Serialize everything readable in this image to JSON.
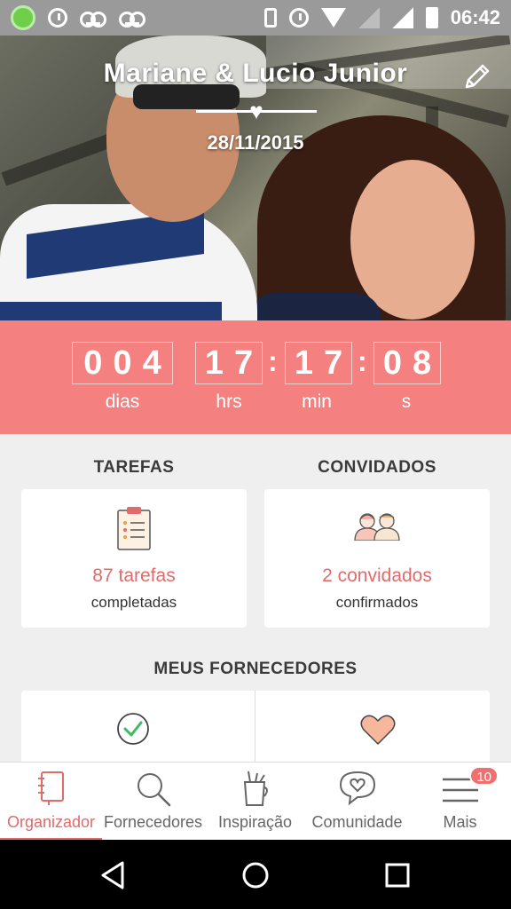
{
  "status_bar": {
    "time": "06:42"
  },
  "header": {
    "couple_names": "Mariane & Lucio Junior",
    "wedding_date": "28/11/2015"
  },
  "countdown": {
    "days": "004",
    "hours": "17",
    "minutes": "17",
    "seconds": "08",
    "days_label": "dias",
    "hours_label": "hrs",
    "minutes_label": "min",
    "seconds_label": "s"
  },
  "tasks": {
    "title": "TAREFAS",
    "count": "87 tarefas",
    "status": "completadas"
  },
  "guests": {
    "title": "CONVIDADOS",
    "count": "2 convidados",
    "status": "confirmados"
  },
  "vendors": {
    "title": "MEUS FORNECEDORES"
  },
  "bottom_nav": {
    "items": [
      {
        "label": "Organizador",
        "icon": "notebook-icon",
        "active": true
      },
      {
        "label": "Fornecedores",
        "icon": "search-icon"
      },
      {
        "label": "Inspiração",
        "icon": "cup-icon"
      },
      {
        "label": "Comunidade",
        "icon": "chat-heart-icon"
      },
      {
        "label": "Mais",
        "icon": "menu-icon",
        "badge": "10"
      }
    ]
  },
  "colors": {
    "accent": "#f48080",
    "accent_text": "#e06b6b"
  }
}
